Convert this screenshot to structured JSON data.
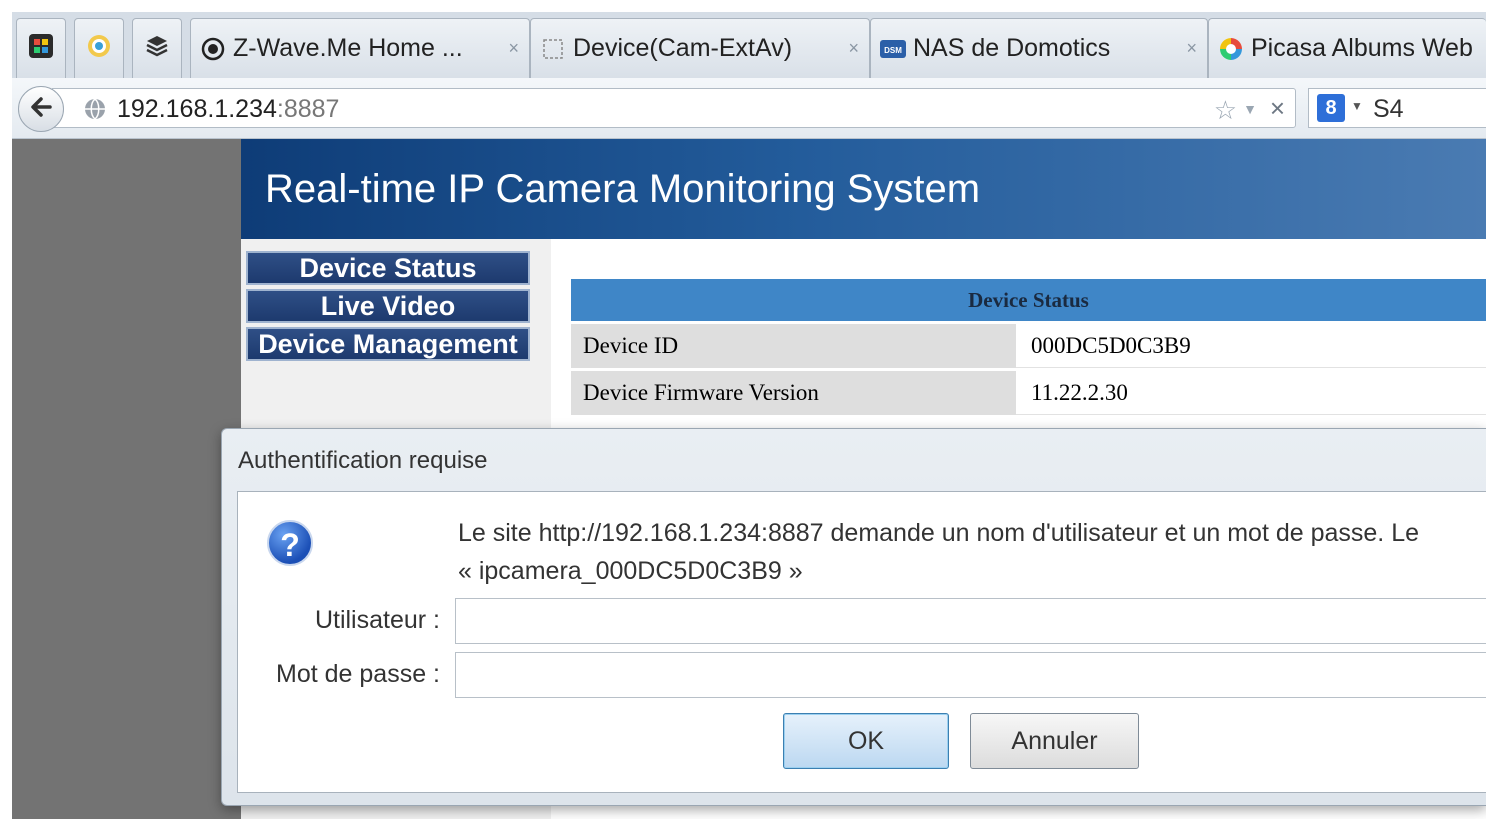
{
  "browser": {
    "tabs": [
      {
        "label": "Z-Wave.Me Home ...",
        "icon": "z-wave-icon"
      },
      {
        "label": "Device(Cam-ExtAv)",
        "icon": "blank-page-icon"
      },
      {
        "label": "NAS de Domotics",
        "icon": "nas-icon"
      },
      {
        "label": "Picasa Albums Web",
        "icon": "picasa-icon"
      }
    ],
    "tab_close_glyph": "×",
    "url_host": "192.168.1.234",
    "url_port": ":8887",
    "search_value": "S4"
  },
  "page": {
    "title": "Real-time IP Camera Monitoring System",
    "nav": [
      "Device Status",
      "Live Video",
      "Device Management"
    ],
    "status_table": {
      "header": "Device Status",
      "rows": [
        {
          "key": "Device ID",
          "value": "000DC5D0C3B9"
        },
        {
          "key": "Device Firmware Version",
          "value": "11.22.2.30"
        }
      ]
    }
  },
  "dialog": {
    "title": "Authentification requise",
    "message_line1": "Le site http://192.168.1.234:8887 demande un nom d'utilisateur et un mot de passe. Le",
    "message_line2": "« ipcamera_000DC5D0C3B9 »",
    "username_label": "Utilisateur :",
    "password_label": "Mot de passe :",
    "username_value": "",
    "password_value": "",
    "ok_label": "OK",
    "cancel_label": "Annuler"
  },
  "colors": {
    "header_blue": "#0e3c77",
    "table_header": "#3f86c7",
    "nav_button": "#1d3a6e",
    "page_background": "#737373"
  }
}
